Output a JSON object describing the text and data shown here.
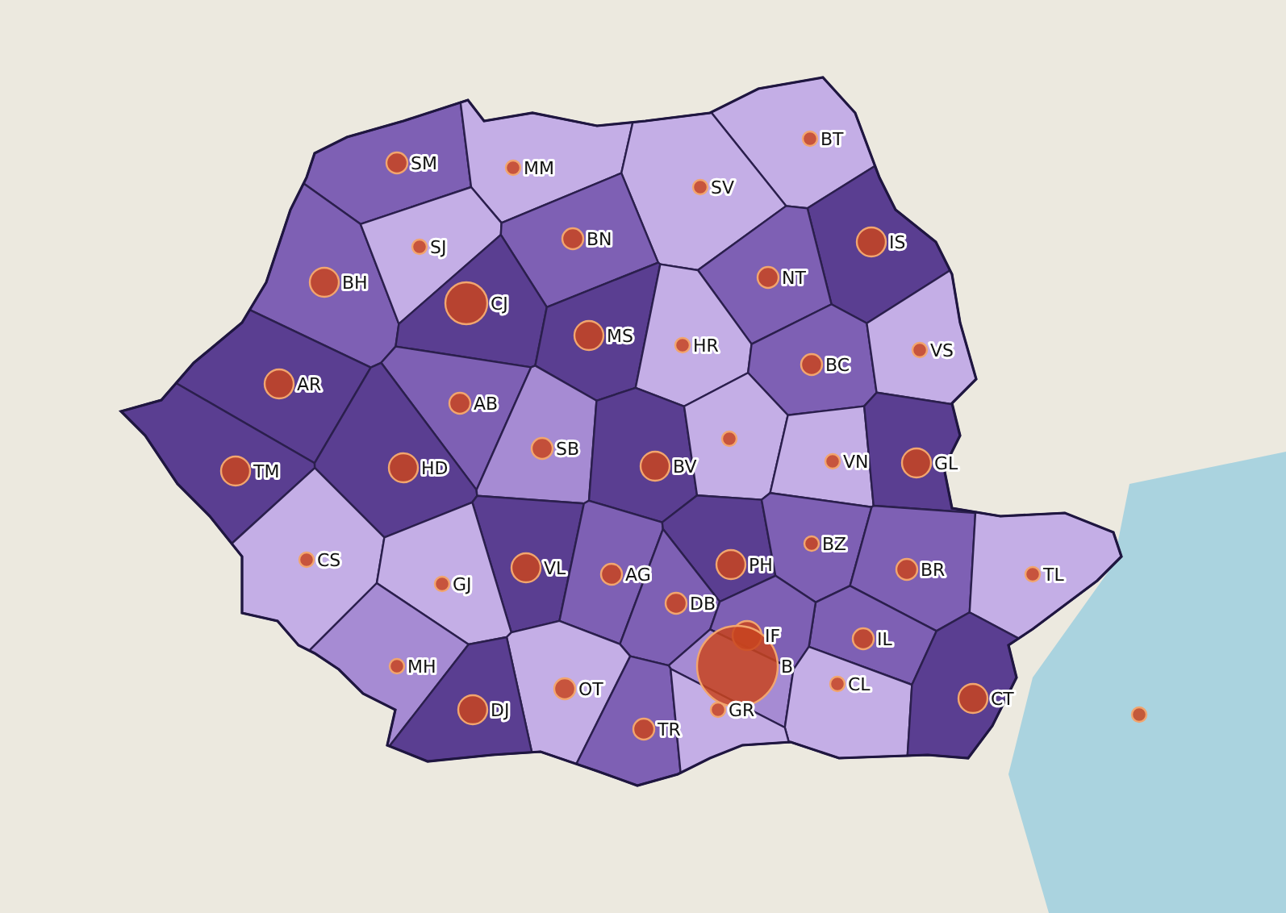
{
  "map": {
    "counties": [
      {
        "code": "SM",
        "color": "#7e60b4",
        "kind": "medium"
      },
      {
        "code": "MM",
        "color": "#c4aee6",
        "kind": "small"
      },
      {
        "code": "BT",
        "color": "#c4aee6",
        "kind": "small"
      },
      {
        "code": "SV",
        "color": "#c4aee6",
        "kind": "small"
      },
      {
        "code": "BH",
        "color": "#7e60b4",
        "kind": "large"
      },
      {
        "code": "SJ",
        "color": "#c4aee6",
        "kind": "small"
      },
      {
        "code": "BN",
        "color": "#7e60b4",
        "kind": "medium"
      },
      {
        "code": "IS",
        "color": "#5a3e91",
        "kind": "large"
      },
      {
        "code": "NT",
        "color": "#7e60b4",
        "kind": "medium"
      },
      {
        "code": "CJ",
        "color": "#5a3e91",
        "kind": "larger"
      },
      {
        "code": "MS",
        "color": "#5a3e91",
        "kind": "large"
      },
      {
        "code": "HR",
        "color": "#c4aee6",
        "kind": "small"
      },
      {
        "code": "BC",
        "color": "#7e60b4",
        "kind": "medium"
      },
      {
        "code": "VS",
        "color": "#c4aee6",
        "kind": "small"
      },
      {
        "code": "AR",
        "color": "#5a3e91",
        "kind": "large"
      },
      {
        "code": "AB",
        "color": "#7e60b4",
        "kind": "medium"
      },
      {
        "code": "TM",
        "color": "#5a3e91",
        "kind": "large"
      },
      {
        "code": "HD",
        "color": "#5a3e91",
        "kind": "large"
      },
      {
        "code": "SB",
        "color": "#a68bd3",
        "kind": "medium"
      },
      {
        "code": "BV",
        "color": "#5a3e91",
        "kind": "large"
      },
      {
        "color": "#c4aee6",
        "kind": "small"
      },
      {
        "code": "VN",
        "color": "#c4aee6",
        "kind": "small"
      },
      {
        "code": "GL",
        "color": "#5a3e91",
        "kind": "large"
      },
      {
        "code": "CS",
        "color": "#c4aee6",
        "kind": "small"
      },
      {
        "code": "VL",
        "color": "#5a3e91",
        "kind": "large"
      },
      {
        "code": "AG",
        "color": "#7e60b4",
        "kind": "medium"
      },
      {
        "code": "PH",
        "color": "#5a3e91",
        "kind": "large"
      },
      {
        "code": "BZ",
        "color": "#7e60b4",
        "kind": "small"
      },
      {
        "code": "BR",
        "color": "#7e60b4",
        "kind": "medium"
      },
      {
        "code": "TL",
        "color": "#c4aee6",
        "kind": "small"
      },
      {
        "code": "GJ",
        "color": "#c4aee6",
        "kind": "small"
      },
      {
        "code": "DB",
        "color": "#7e60b4",
        "kind": "medium"
      },
      {
        "code": "MH",
        "color": "#a68bd3",
        "kind": "small"
      },
      {
        "code": "IL",
        "color": "#7e60b4",
        "kind": "medium"
      },
      {
        "code": "IF",
        "color": "#7e60b4",
        "kind": "large"
      },
      {
        "code": "B",
        "color": "#a68bd3",
        "kind": "largest"
      },
      {
        "code": "CL",
        "color": "#c4aee6",
        "kind": "small"
      },
      {
        "code": "OT",
        "color": "#c4aee6",
        "kind": "medium"
      },
      {
        "code": "DJ",
        "color": "#5a3e91",
        "kind": "large"
      },
      {
        "code": "TR",
        "color": "#7e60b4",
        "kind": "medium"
      },
      {
        "code": "GR",
        "color": "#c4aee6",
        "kind": "small"
      },
      {
        "code": "CT",
        "color": "#5a3e91",
        "kind": "large"
      }
    ],
    "extra_markers": [
      {
        "kind": "small"
      }
    ]
  }
}
